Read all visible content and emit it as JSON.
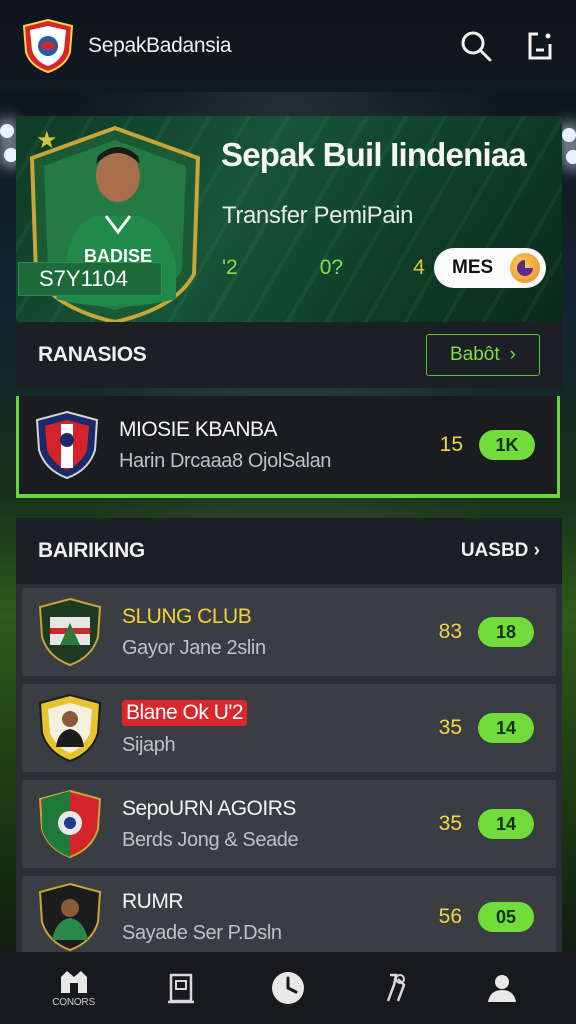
{
  "app": {
    "title": "SepakBadansia"
  },
  "hero": {
    "title": "Sepak Buil Iindeniaa",
    "subtitle": "Transfer PemiPain",
    "player_id": "S7Y1104",
    "stats": [
      "'2",
      "0?",
      "4"
    ],
    "button_label": "MES"
  },
  "section_ranasios": {
    "title": "RANASIOS",
    "button_label": "Babôt",
    "featured": {
      "name": "MIOSIE KBANBA",
      "sub": "Harin Drcaaa8 OjolSalan",
      "score": "15",
      "badge": "1K"
    }
  },
  "section_ranking": {
    "title": "BAIRIKING",
    "link_label": "UASBD",
    "rows": [
      {
        "name": "SLUNG CLUB",
        "sub": "Gayor Jane 2slin",
        "score": "83",
        "badge": "18",
        "style": "yellow"
      },
      {
        "name": "Blane Ok U'2",
        "sub": "Sijaph",
        "score": "35",
        "badge": "14",
        "style": "red"
      },
      {
        "name": "SepoURN AGOIRS",
        "sub": "Berds Jong & Seade",
        "score": "35",
        "badge": "14",
        "style": "white"
      },
      {
        "name": "RUMR",
        "sub": "Sayade Ser P.Dsln",
        "score": "56",
        "badge": "05",
        "style": "white"
      }
    ]
  },
  "bottom_nav": {
    "items": [
      {
        "label": "CONORS",
        "icon": "stadium-icon"
      },
      {
        "label": "",
        "icon": "clipboard-icon"
      },
      {
        "label": "",
        "icon": "clock-icon"
      },
      {
        "label": "",
        "icon": "tools-icon"
      },
      {
        "label": "",
        "icon": "profile-icon"
      }
    ]
  },
  "colors": {
    "accent_green": "#72dc3b",
    "score_yellow": "#f0d64b",
    "alert_red": "#d9272e",
    "panel_dark": "#1c1f23"
  }
}
